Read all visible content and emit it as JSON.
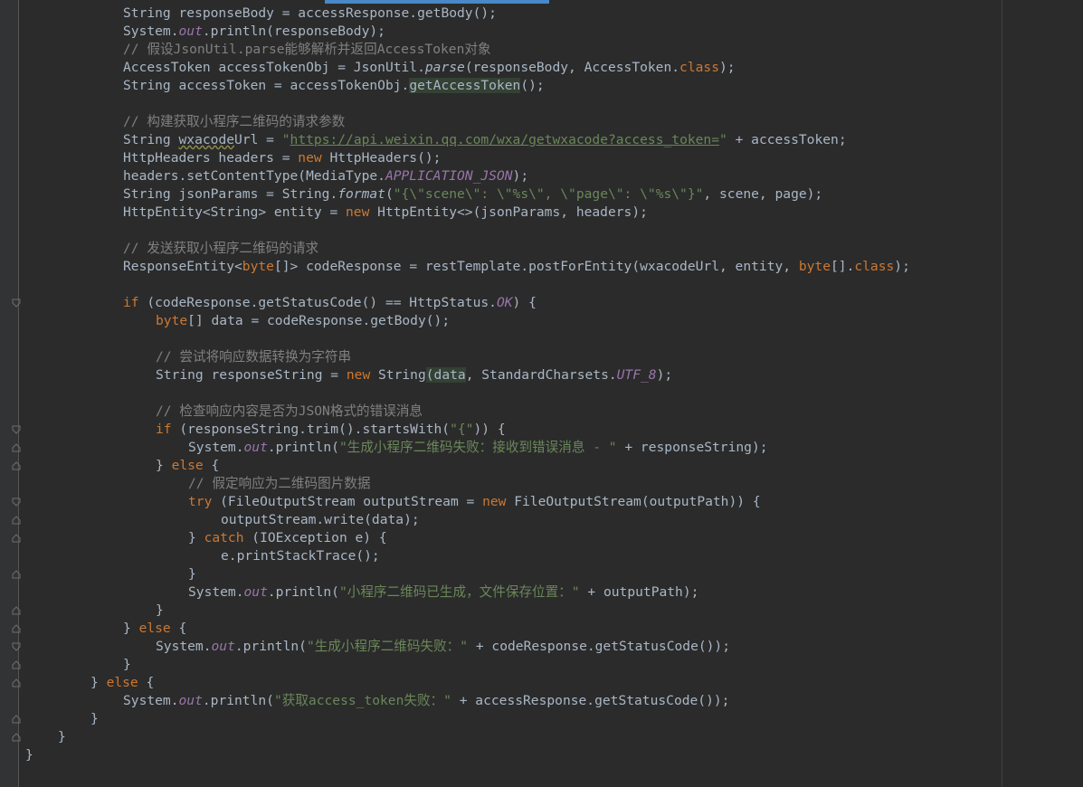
{
  "editor": {
    "theme": {
      "background": "#2b2b2b",
      "keyword": "#cc7832",
      "string": "#6a8759",
      "comment": "#808080",
      "field": "#9876aa"
    },
    "lines": [
      {
        "indent": 3,
        "tokens": [
          [
            "String responseBody = accessResponse.getBody();",
            ""
          ]
        ]
      },
      {
        "indent": 3,
        "tokens": [
          [
            "System.",
            ""
          ],
          [
            "out",
            "fd"
          ],
          [
            ".println(responseBody);",
            ""
          ]
        ]
      },
      {
        "indent": 3,
        "tokens": [
          [
            "// 假设JsonUtil.parse能够解析并返回AccessToken对象",
            "cm"
          ]
        ]
      },
      {
        "indent": 3,
        "tokens": [
          [
            "AccessToken accessTokenObj = JsonUtil.",
            ""
          ],
          [
            "parse",
            "it"
          ],
          [
            "(responseBody, AccessToken.",
            ""
          ],
          [
            "class",
            "kw"
          ],
          [
            ");",
            ""
          ]
        ]
      },
      {
        "indent": 3,
        "tokens": [
          [
            "String accessToken = accessTokenObj.",
            ""
          ],
          [
            "getAccessToken",
            "hl"
          ],
          [
            "();",
            ""
          ]
        ]
      },
      {
        "indent": 0,
        "tokens": []
      },
      {
        "indent": 3,
        "tokens": [
          [
            "// 构建获取小程序二维码的请求参数",
            "cm"
          ]
        ]
      },
      {
        "indent": 3,
        "tokens": [
          [
            "String ",
            ""
          ],
          [
            "wxacode",
            "sq"
          ],
          [
            "Url = ",
            ""
          ],
          [
            "\"",
            "st"
          ],
          [
            "https://api.weixin.qq.com/wxa/getwxacode?access_token=",
            "lk"
          ],
          [
            "\"",
            "st"
          ],
          [
            " + accessToken;",
            ""
          ]
        ]
      },
      {
        "indent": 3,
        "tokens": [
          [
            "HttpHeaders headers = ",
            ""
          ],
          [
            "new",
            "kw"
          ],
          [
            " HttpHeaders();",
            ""
          ]
        ]
      },
      {
        "indent": 3,
        "tokens": [
          [
            "headers.setContentType(MediaType.",
            ""
          ],
          [
            "APPLICATION_JSON",
            "fd"
          ],
          [
            ");",
            ""
          ]
        ]
      },
      {
        "indent": 3,
        "tokens": [
          [
            "String jsonParams = String.",
            ""
          ],
          [
            "format",
            "it"
          ],
          [
            "(",
            ""
          ],
          [
            "\"{\\\"scene\\\": \\\"%s\\\", \\\"page\\\": \\\"%s\\\"}\"",
            "st"
          ],
          [
            ", scene, page);",
            ""
          ]
        ]
      },
      {
        "indent": 3,
        "tokens": [
          [
            "HttpEntity<String> entity = ",
            ""
          ],
          [
            "new",
            "kw"
          ],
          [
            " HttpEntity<>(jsonParams, headers);",
            ""
          ]
        ]
      },
      {
        "indent": 0,
        "tokens": []
      },
      {
        "indent": 3,
        "tokens": [
          [
            "// 发送获取小程序二维码的请求",
            "cm"
          ]
        ]
      },
      {
        "indent": 3,
        "tokens": [
          [
            "ResponseEntity<",
            ""
          ],
          [
            "byte",
            "kw"
          ],
          [
            "[]> codeResponse = restTemplate.postForEntity(wxacodeUrl, entity, ",
            ""
          ],
          [
            "byte",
            "kw"
          ],
          [
            "[].",
            ""
          ],
          [
            "class",
            "kw"
          ],
          [
            ");",
            ""
          ]
        ]
      },
      {
        "indent": 0,
        "tokens": []
      },
      {
        "indent": 3,
        "tokens": [
          [
            "if",
            "kw"
          ],
          [
            " (codeResponse.getStatusCode() == HttpStatus.",
            ""
          ],
          [
            "OK",
            "fd"
          ],
          [
            ") {",
            ""
          ]
        ]
      },
      {
        "indent": 4,
        "tokens": [
          [
            "byte",
            "kw"
          ],
          [
            "[] data = codeResponse.getBody();",
            ""
          ]
        ]
      },
      {
        "indent": 0,
        "tokens": []
      },
      {
        "indent": 4,
        "tokens": [
          [
            "// 尝试将响应数据转换为字符串",
            "cm"
          ]
        ]
      },
      {
        "indent": 4,
        "tokens": [
          [
            "String responseString = ",
            ""
          ],
          [
            "new",
            "kw"
          ],
          [
            " String",
            ""
          ],
          [
            "(",
            "hl"
          ],
          [
            "data",
            "hl"
          ],
          [
            ", StandardCharsets.",
            ""
          ],
          [
            "UTF_8",
            "fd"
          ],
          [
            ");",
            ""
          ]
        ]
      },
      {
        "indent": 0,
        "tokens": []
      },
      {
        "indent": 4,
        "tokens": [
          [
            "// 检查响应内容是否为JSON格式的错误消息",
            "cm"
          ]
        ]
      },
      {
        "indent": 4,
        "tokens": [
          [
            "if",
            "kw"
          ],
          [
            " (responseString.trim().startsWith(",
            ""
          ],
          [
            "\"{\"",
            "st"
          ],
          [
            ")) {",
            ""
          ]
        ]
      },
      {
        "indent": 5,
        "tokens": [
          [
            "System.",
            ""
          ],
          [
            "out",
            "fd"
          ],
          [
            ".println(",
            ""
          ],
          [
            "\"生成小程序二维码失败：接收到错误消息 - \"",
            "st"
          ],
          [
            " + responseString);",
            ""
          ]
        ]
      },
      {
        "indent": 4,
        "tokens": [
          [
            "} ",
            ""
          ],
          [
            "else",
            "kw"
          ],
          [
            " {",
            ""
          ]
        ]
      },
      {
        "indent": 5,
        "tokens": [
          [
            "// 假定响应为二维码图片数据",
            "cm"
          ]
        ]
      },
      {
        "indent": 5,
        "tokens": [
          [
            "try",
            "kw"
          ],
          [
            " (FileOutputStream outputStream = ",
            ""
          ],
          [
            "new",
            "kw"
          ],
          [
            " FileOutputStream(outputPath)) {",
            ""
          ]
        ]
      },
      {
        "indent": 6,
        "tokens": [
          [
            "outputStream.write(data);",
            ""
          ]
        ]
      },
      {
        "indent": 5,
        "tokens": [
          [
            "} ",
            ""
          ],
          [
            "catch",
            "kw"
          ],
          [
            " (IOException e) {",
            ""
          ]
        ]
      },
      {
        "indent": 6,
        "tokens": [
          [
            "e.printStackTrace();",
            ""
          ]
        ]
      },
      {
        "indent": 5,
        "tokens": [
          [
            "}",
            ""
          ]
        ]
      },
      {
        "indent": 5,
        "tokens": [
          [
            "System.",
            ""
          ],
          [
            "out",
            "fd"
          ],
          [
            ".println(",
            ""
          ],
          [
            "\"小程序二维码已生成，文件保存位置：\"",
            "st"
          ],
          [
            " + outputPath);",
            ""
          ]
        ]
      },
      {
        "indent": 4,
        "tokens": [
          [
            "}",
            ""
          ]
        ]
      },
      {
        "indent": 3,
        "tokens": [
          [
            "} ",
            ""
          ],
          [
            "else",
            "kw"
          ],
          [
            " {",
            ""
          ]
        ]
      },
      {
        "indent": 4,
        "tokens": [
          [
            "System.",
            ""
          ],
          [
            "out",
            "fd"
          ],
          [
            ".println(",
            ""
          ],
          [
            "\"生成小程序二维码失败：\"",
            "st"
          ],
          [
            " + codeResponse.getStatusCode());",
            ""
          ]
        ]
      },
      {
        "indent": 3,
        "tokens": [
          [
            "}",
            ""
          ]
        ]
      },
      {
        "indent": 2,
        "tokens": [
          [
            "} ",
            ""
          ],
          [
            "else",
            "kw"
          ],
          [
            " {",
            ""
          ]
        ]
      },
      {
        "indent": 3,
        "tokens": [
          [
            "System.",
            ""
          ],
          [
            "out",
            "fd"
          ],
          [
            ".println(",
            ""
          ],
          [
            "\"获取access_token失败：\"",
            "st"
          ],
          [
            " + accessResponse.getStatusCode());",
            ""
          ]
        ]
      },
      {
        "indent": 2,
        "tokens": [
          [
            "}",
            ""
          ]
        ]
      },
      {
        "indent": 1,
        "tokens": [
          [
            "}",
            ""
          ]
        ]
      },
      {
        "indent": 0,
        "tokens": [
          [
            "}",
            ""
          ]
        ]
      }
    ],
    "fold_markers": [
      {
        "line": 16,
        "kind": "open"
      },
      {
        "line": 23,
        "kind": "open"
      },
      {
        "line": 24,
        "kind": "close"
      },
      {
        "line": 25,
        "kind": "close"
      },
      {
        "line": 27,
        "kind": "open"
      },
      {
        "line": 28,
        "kind": "close"
      },
      {
        "line": 29,
        "kind": "close"
      },
      {
        "line": 31,
        "kind": "close"
      },
      {
        "line": 33,
        "kind": "close"
      },
      {
        "line": 34,
        "kind": "close"
      },
      {
        "line": 35,
        "kind": "open"
      },
      {
        "line": 36,
        "kind": "close"
      },
      {
        "line": 37,
        "kind": "close"
      },
      {
        "line": 39,
        "kind": "close"
      },
      {
        "line": 40,
        "kind": "close"
      }
    ]
  }
}
